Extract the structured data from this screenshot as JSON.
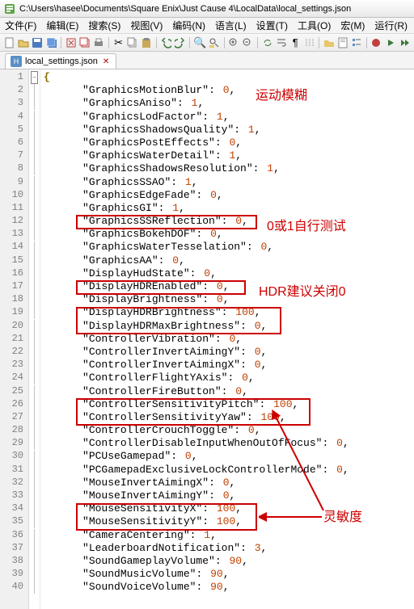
{
  "window": {
    "path": "C:\\Users\\hasee\\Documents\\Square Enix\\Just Cause 4\\LocalData\\local_settings.json"
  },
  "menu": {
    "file": "文件(F)",
    "edit": "编辑(E)",
    "search": "搜索(S)",
    "view": "视图(V)",
    "encode": "编码(N)",
    "language": "语言(L)",
    "settings": "设置(T)",
    "tools": "工具(O)",
    "macro": "宏(M)",
    "run": "运行(R)"
  },
  "tab": {
    "label": "local_settings.json",
    "close": "✕"
  },
  "code": {
    "lines": [
      {
        "n": 1,
        "indent": 0,
        "open_brace": true
      },
      {
        "n": 2,
        "indent": 1,
        "key": "GraphicsMotionBlur",
        "val": 0
      },
      {
        "n": 3,
        "indent": 1,
        "key": "GraphicsAniso",
        "val": 1
      },
      {
        "n": 4,
        "indent": 1,
        "key": "GraphicsLodFactor",
        "val": 1
      },
      {
        "n": 5,
        "indent": 1,
        "key": "GraphicsShadowsQuality",
        "val": 1
      },
      {
        "n": 6,
        "indent": 1,
        "key": "GraphicsPostEffects",
        "val": 0
      },
      {
        "n": 7,
        "indent": 1,
        "key": "GraphicsWaterDetail",
        "val": 1
      },
      {
        "n": 8,
        "indent": 1,
        "key": "GraphicsShadowsResolution",
        "val": 1
      },
      {
        "n": 9,
        "indent": 1,
        "key": "GraphicsSSAO",
        "val": 1
      },
      {
        "n": 10,
        "indent": 1,
        "key": "GraphicsEdgeFade",
        "val": 0
      },
      {
        "n": 11,
        "indent": 1,
        "key": "GraphicsGI",
        "val": 1
      },
      {
        "n": 12,
        "indent": 1,
        "key": "GraphicsSSReflection",
        "val": 0
      },
      {
        "n": 13,
        "indent": 1,
        "key": "GraphicsBokehDOF",
        "val": 0
      },
      {
        "n": 14,
        "indent": 1,
        "key": "GraphicsWaterTesselation",
        "val": 0
      },
      {
        "n": 15,
        "indent": 1,
        "key": "GraphicsAA",
        "val": 0
      },
      {
        "n": 16,
        "indent": 1,
        "key": "DisplayHudState",
        "val": 0
      },
      {
        "n": 17,
        "indent": 1,
        "key": "DisplayHDREnabled",
        "val": 0
      },
      {
        "n": 18,
        "indent": 1,
        "key": "DisplayBrightness",
        "val": 0
      },
      {
        "n": 19,
        "indent": 1,
        "key": "DisplayHDRBrightness",
        "val": 100
      },
      {
        "n": 20,
        "indent": 1,
        "key": "DisplayHDRMaxBrightness",
        "val": 0
      },
      {
        "n": 21,
        "indent": 1,
        "key": "ControllerVibration",
        "val": 0
      },
      {
        "n": 22,
        "indent": 1,
        "key": "ControllerInvertAimingY",
        "val": 0
      },
      {
        "n": 23,
        "indent": 1,
        "key": "ControllerInvertAimingX",
        "val": 0
      },
      {
        "n": 24,
        "indent": 1,
        "key": "ControllerFlightYAxis",
        "val": 0
      },
      {
        "n": 25,
        "indent": 1,
        "key": "ControllerFireButton",
        "val": 0
      },
      {
        "n": 26,
        "indent": 1,
        "key": "ControllerSensitivityPitch",
        "val": 100
      },
      {
        "n": 27,
        "indent": 1,
        "key": "ControllerSensitivityYaw",
        "val": 100
      },
      {
        "n": 28,
        "indent": 1,
        "key": "ControllerCrouchToggle",
        "val": 0
      },
      {
        "n": 29,
        "indent": 1,
        "key": "ControllerDisableInputWhenOutOfFocus",
        "val": 0
      },
      {
        "n": 30,
        "indent": 1,
        "key": "PCUseGamepad",
        "val": 0
      },
      {
        "n": 31,
        "indent": 1,
        "key": "PCGamepadExclusiveLockControllerMode",
        "val": 0
      },
      {
        "n": 32,
        "indent": 1,
        "key": "MouseInvertAimingX",
        "val": 0
      },
      {
        "n": 33,
        "indent": 1,
        "key": "MouseInvertAimingY",
        "val": 0
      },
      {
        "n": 34,
        "indent": 1,
        "key": "MouseSensitivityX",
        "val": 100
      },
      {
        "n": 35,
        "indent": 1,
        "key": "MouseSensitivityY",
        "val": 100
      },
      {
        "n": 36,
        "indent": 1,
        "key": "CameraCentering",
        "val": 1
      },
      {
        "n": 37,
        "indent": 1,
        "key": "LeaderboardNotification",
        "val": 3
      },
      {
        "n": 38,
        "indent": 1,
        "key": "SoundGameplayVolume",
        "val": 90
      },
      {
        "n": 39,
        "indent": 1,
        "key": "SoundMusicVolume",
        "val": 90
      },
      {
        "n": 40,
        "indent": 1,
        "key": "SoundVoiceVolume",
        "val": 90
      }
    ]
  },
  "annotations": {
    "motion_blur": "运动模糊",
    "ssreflection": "0或1自行测试",
    "hdr_disable": "HDR建议关闭0",
    "sensitivity": "灵敏度"
  }
}
